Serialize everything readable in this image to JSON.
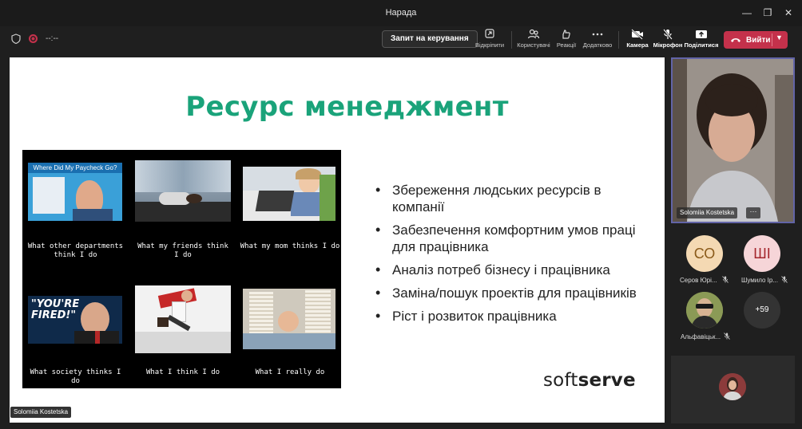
{
  "window": {
    "title": "Нарада"
  },
  "toolbar": {
    "timer": "--:--",
    "request_control": "Запит на керування",
    "unpin": "Відкріпити",
    "people": "Користувачі",
    "reactions": "Реакції",
    "more": "Додатково",
    "camera": "Камера",
    "mic": "Мікрофон",
    "share": "Поділитися",
    "leave": "Вийти"
  },
  "slide": {
    "title": "Ресурс менеджмент",
    "meme_header": "Where Did My Paycheck Go?",
    "meme_fired": "\"YOU'RE FIRED!\"",
    "captions": [
      "What other departments think I do",
      "What my friends think I do",
      "What my mom thinks I do",
      "What society thinks I do",
      "What I think I do",
      "What I really do"
    ],
    "bullets": [
      "Збереження людських ресурсів в компанії",
      "Забезпечення комфортним умов праці для працівника",
      "Аналіз потреб бізнесу і працівника",
      "Заміна/пошук проектів для працівників",
      "Ріст і розвиток працівника"
    ],
    "logo_light": "soft",
    "logo_bold": "serve"
  },
  "presenter_tag": "Solomiia Kostetska",
  "camera_tile": {
    "name": "Solomiia Kostetska",
    "more": "···"
  },
  "participants": [
    {
      "initials": "СО",
      "name": "Серов Юрі...",
      "bg": "#f4d9b3",
      "fg": "#8a5a1a"
    },
    {
      "initials": "ШІ",
      "name": "Шумило Ір...",
      "bg": "#f6d5d8",
      "fg": "#a4262c"
    },
    {
      "initials": "",
      "name": "Альфавіцьк..."
    }
  ],
  "overflow_count": "+59",
  "colors": {
    "accent": "#6264a7",
    "leave": "#c4314b",
    "slide_title": "#1aa37a"
  }
}
